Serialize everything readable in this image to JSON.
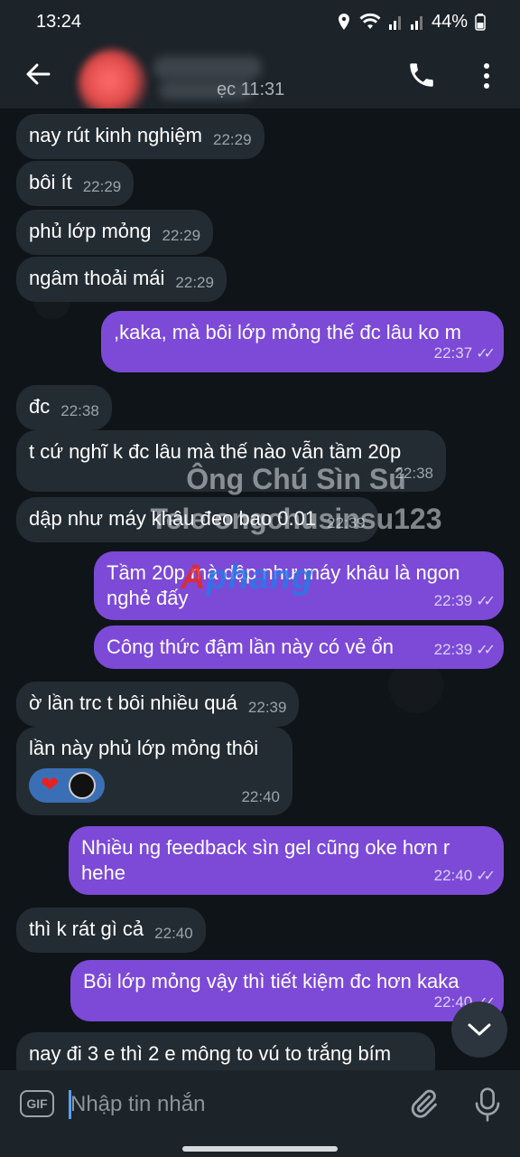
{
  "status_bar": {
    "time": "13:24",
    "battery": "44%"
  },
  "header": {
    "subtitle": "ẹc 11:31"
  },
  "watermark": {
    "line1": "Ông Chú Sìn Sú",
    "line2": "Tele ongchusinsu123",
    "logo_a": "A",
    "logo_b": "phang"
  },
  "messages": [
    {
      "dir": "in",
      "text": "nay rút kinh nghiệm",
      "time": "22:29"
    },
    {
      "dir": "in",
      "text": "bôi ít",
      "time": "22:29"
    },
    {
      "dir": "in",
      "text": "phủ lớp mỏng",
      "time": "22:29"
    },
    {
      "dir": "in",
      "text": "ngâm thoải mái",
      "time": "22:29"
    },
    {
      "dir": "out",
      "text": ",kaka, mà bôi lớp mỏng thế đc lâu ko m",
      "time": "22:37"
    },
    {
      "dir": "in",
      "text": "đc",
      "time": "22:38"
    },
    {
      "dir": "in",
      "text": "t cứ nghĩ k đc lâu mà thế nào vẫn tầm 20p",
      "time": "22:38"
    },
    {
      "dir": "in",
      "text": "dập như máy khâu đeo bao 0.01",
      "time": "22:39"
    },
    {
      "dir": "out",
      "text": "Tầm 20p mà dập như máy khâu là ngon nghẻ đấy",
      "time": "22:39"
    },
    {
      "dir": "out",
      "text": "Công thức đậm lần này có vẻ ổn",
      "time": "22:39"
    },
    {
      "dir": "in",
      "text": "ờ lần trc t bôi nhiều quá",
      "time": "22:39"
    },
    {
      "dir": "in",
      "text": "lần này phủ lớp mỏng thôi",
      "time": "22:40"
    },
    {
      "dir": "out",
      "text": "Nhiều ng feedback  sìn gel cũng oke hơn r hehe",
      "time": "22:40"
    },
    {
      "dir": "in",
      "text": "thì k rát gì cả",
      "time": "22:40"
    },
    {
      "dir": "out",
      "text": "Bôi lớp mỏng vậy thì tiết kiệm đc hơn kaka",
      "time": "22:40"
    },
    {
      "dir": "in",
      "text": "nay đi 3 e thì 2 e mông to vú to trắng bím",
      "time": ""
    }
  ],
  "reactions": {
    "heart": "❤"
  },
  "input": {
    "placeholder": "Nhập tin nhắn",
    "gif_label": "GIF"
  },
  "icons": {
    "back": "arrow-left-icon",
    "call": "phone-icon",
    "menu": "more-vertical-icon",
    "scroll": "chevron-down-icon",
    "attach": "paperclip-icon",
    "mic": "microphone-icon"
  }
}
